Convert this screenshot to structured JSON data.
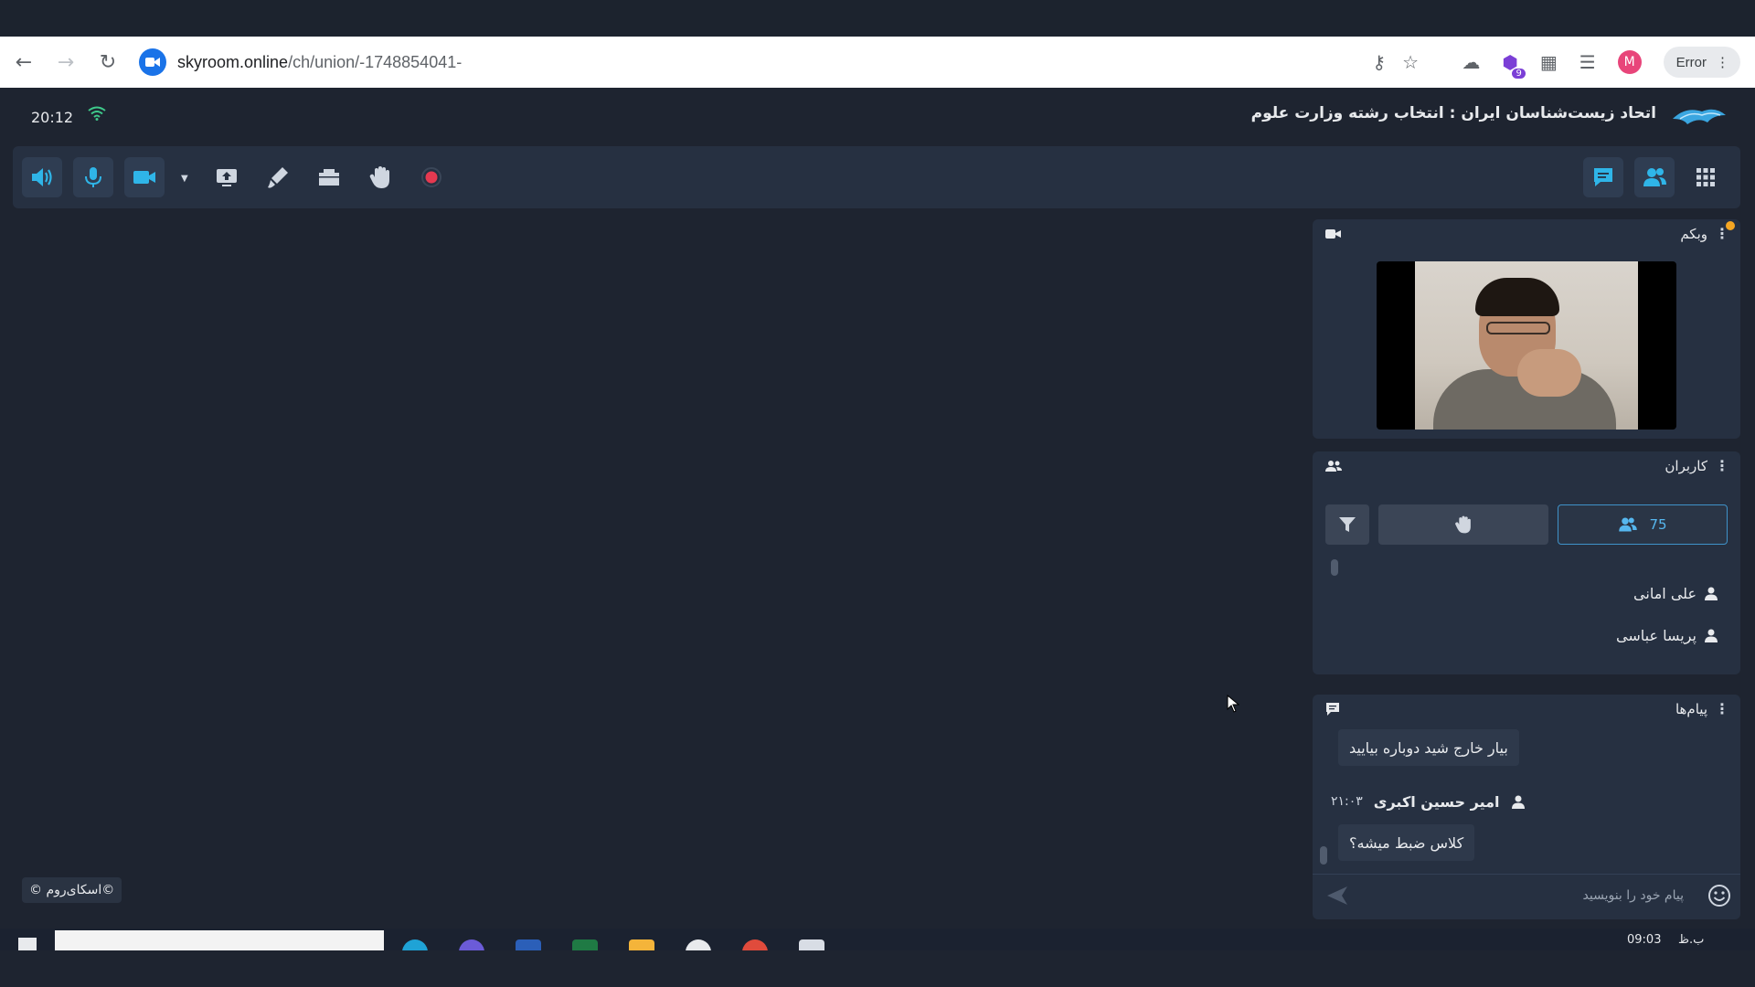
{
  "browser": {
    "url_host": "skyroom.online",
    "url_path": "/ch/union/-1748854041-",
    "extension_badge": "9",
    "profile_initial": "M",
    "error_label": "Error"
  },
  "header": {
    "clock": "20:12",
    "room_title": "اتحاد زیست‌شناسان ایران : انتخاب رشته وزارت علوم"
  },
  "panels": {
    "webcam_title": "وبکم",
    "users_title": "کاربران",
    "messages_title": "پیام‌ها"
  },
  "users": {
    "count": "75",
    "list": [
      "علی امانی",
      "پریسا عباسی"
    ]
  },
  "messages": {
    "items": [
      {
        "text": "بیار خارج شید دوباره بیایید"
      },
      {
        "author": "امیر حسین اکبری",
        "time": "۲۱:۰۳",
        "text": "کلاس ضبط میشه؟"
      }
    ],
    "compose_placeholder": "پیام خود را بنویسید"
  },
  "watermark": "©اسکای‌روم ©",
  "taskbar": {
    "time": "09:03",
    "date": "ب.ظ"
  },
  "colors": {
    "accent": "#2fb5e8",
    "panel": "#263041",
    "background": "#1e2430",
    "record": "#e53950",
    "notify": "#f5a623",
    "online": "#3ec98a"
  },
  "icons": {
    "toolbar": [
      "speaker-icon",
      "microphone-icon",
      "camera-icon",
      "share-screen-icon",
      "whiteboard-icon",
      "files-icon",
      "raise-hand-icon",
      "record-icon"
    ],
    "right": [
      "chat-icon",
      "users-icon",
      "grid-icon"
    ]
  }
}
